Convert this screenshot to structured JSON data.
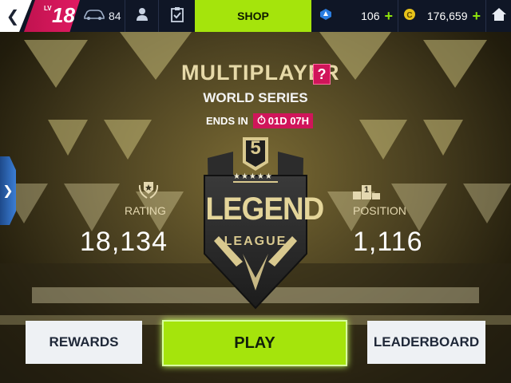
{
  "topbar": {
    "back_icon": "chevron-left-icon",
    "level_label": "LV",
    "level_value": "18",
    "cars_count": "84",
    "shop_label": "SHOP",
    "tokens_value": "106",
    "credits_value": "176,659",
    "plus_symbol": "+"
  },
  "header": {
    "title": "MULTIPLAYER",
    "help_label": "?",
    "subtitle": "WORLD SERIES",
    "ends_label": "ENDS IN",
    "ends_value": "01D 07H"
  },
  "league": {
    "rank_number": "5",
    "name": "LEGEND",
    "sub": "LEAGUE",
    "stars": "★★★★★"
  },
  "stats": {
    "rating_label": "RATING",
    "rating_value": "18,134",
    "position_label": "POSITION",
    "position_value": "1,116",
    "podium_number": "1"
  },
  "buttons": {
    "rewards": "REWARDS",
    "play": "PLAY",
    "leaderboard": "LEADERBOARD"
  },
  "colors": {
    "accent_green": "#a5e40c",
    "accent_pink": "#d0155a",
    "topbar": "#0f1626",
    "gold": "#e6d9a8"
  }
}
